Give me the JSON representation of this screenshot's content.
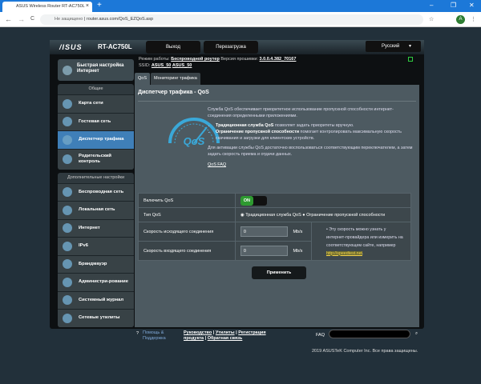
{
  "browser": {
    "tab_title": "ASUS Wireless Router RT-AC750L",
    "close": "×",
    "new_tab": "+",
    "minimize": "–",
    "maximize": "❐",
    "close_window": "✕",
    "back": "←",
    "forward": "→",
    "reload": "C",
    "security": "Не защищено",
    "url": "router.asus.com/QoS_EZQoS.asp",
    "star": "☆",
    "avatar": "A",
    "menu": "⋮"
  },
  "header": {
    "logo": "/ISUS",
    "model": "RT-AC750L",
    "logout": "Выход",
    "reboot": "Перезагрузка",
    "language": "Русский"
  },
  "info": {
    "mode_label": "Режим работы:",
    "mode": "Беспроводной роутер",
    "fw_label": "Версия прошивки:",
    "fw": "3.0.0.4.382_70167",
    "ssid_label": "SSID:",
    "ssid1": "ASUS_50",
    "ssid2": "ASUS_50"
  },
  "sidebar": {
    "quick_setup": "Быстрая настройка Интернет",
    "general": "Общие",
    "general_items": [
      "Карта сети",
      "Гостевая сеть",
      "Диспетчер трафика",
      "Родительский контроль"
    ],
    "advanced": "Дополнительные настройки",
    "advanced_items": [
      "Беспроводная сеть",
      "Локальная сеть",
      "Интернет",
      "IPv6",
      "Брандмауэр",
      "Администри-рование",
      "Системный журнал",
      "Сетевые утилиты"
    ]
  },
  "tabs": [
    "QoS",
    "Мониторинг трафика"
  ],
  "content": {
    "title": "Диспетчер трафика - QoS",
    "intro": "Служба QoS обеспечивает приоритетное использование пропускной способности интернет-соединения определенными приложениями.",
    "b1_bold": "Традиционная служба QoS",
    "b1": " позволяет задать приоритеты вручную.",
    "b2_bold": "Ограничение пропускной способности",
    "b2": " помогает контролировать максимальную скорость скачивания и загрузки для клиентских устройств.",
    "activate": "Для активации службы QoS достаточно воспользоваться соответствующим переключателем, а затем задать скорость приема и отдачи данных.",
    "faq": "QoS FAQ",
    "logo_text": "QoS"
  },
  "form": {
    "enable_label": "Включить QoS",
    "enable_value": "ON",
    "type_label": "Тип QoS",
    "type_opt1": "Традиционная служба QoS",
    "type_opt2": "Ограничение пропускной способности",
    "up_label": "Скорость исходящего соединения",
    "up_value": "0",
    "down_label": "Скорость входящего соединения",
    "down_value": "0",
    "unit": "Mb/s",
    "note": "Эту скорость можно узнать у интернет-провайдера или измерить на соответствующем сайте, например ",
    "note_link": "http://speedtest.net",
    "apply": "Применить"
  },
  "footer": {
    "help": "Помощь & Поддержка",
    "manual": "Руководство",
    "utils": "Утилиты",
    "register": "Регистрация продукта",
    "feedback": "Обратная связь",
    "faq": "FAQ",
    "copyright": "2019 ASUSTeK Computer Inc. Все права защищены."
  }
}
